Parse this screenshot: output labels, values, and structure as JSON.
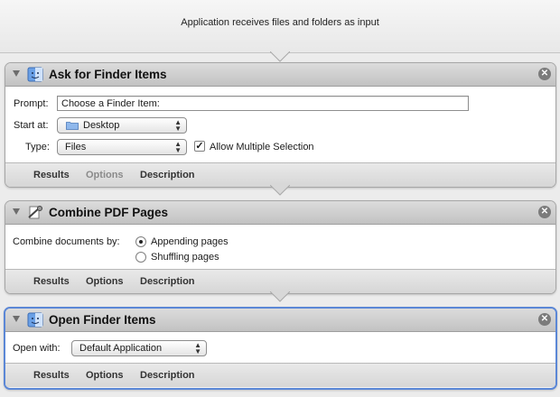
{
  "header": {
    "text": "Application receives files and folders as input"
  },
  "actions": [
    {
      "title": "Ask for Finder Items",
      "icon": "finder-icon",
      "prompt_label": "Prompt:",
      "prompt_value": "Choose a Finder Item:",
      "start_label": "Start at:",
      "start_value": "Desktop",
      "type_label": "Type:",
      "type_value": "Files",
      "allow_multiple_label": "Allow Multiple Selection",
      "allow_multiple_checked": true,
      "tabs": {
        "results": "Results",
        "options": "Options",
        "description": "Description"
      }
    },
    {
      "title": "Combine PDF Pages",
      "icon": "pdf-tools-icon",
      "combine_label": "Combine documents by:",
      "option_appending": "Appending pages",
      "option_shuffling": "Shuffling pages",
      "selected_option": "Appending pages",
      "tabs": {
        "results": "Results",
        "options": "Options",
        "description": "Description"
      }
    },
    {
      "title": "Open Finder Items",
      "icon": "finder-icon",
      "open_with_label": "Open with:",
      "open_with_value": "Default Application",
      "tabs": {
        "results": "Results",
        "options": "Options",
        "description": "Description"
      }
    }
  ],
  "colors": {
    "selection_border": "#5b87d6"
  }
}
